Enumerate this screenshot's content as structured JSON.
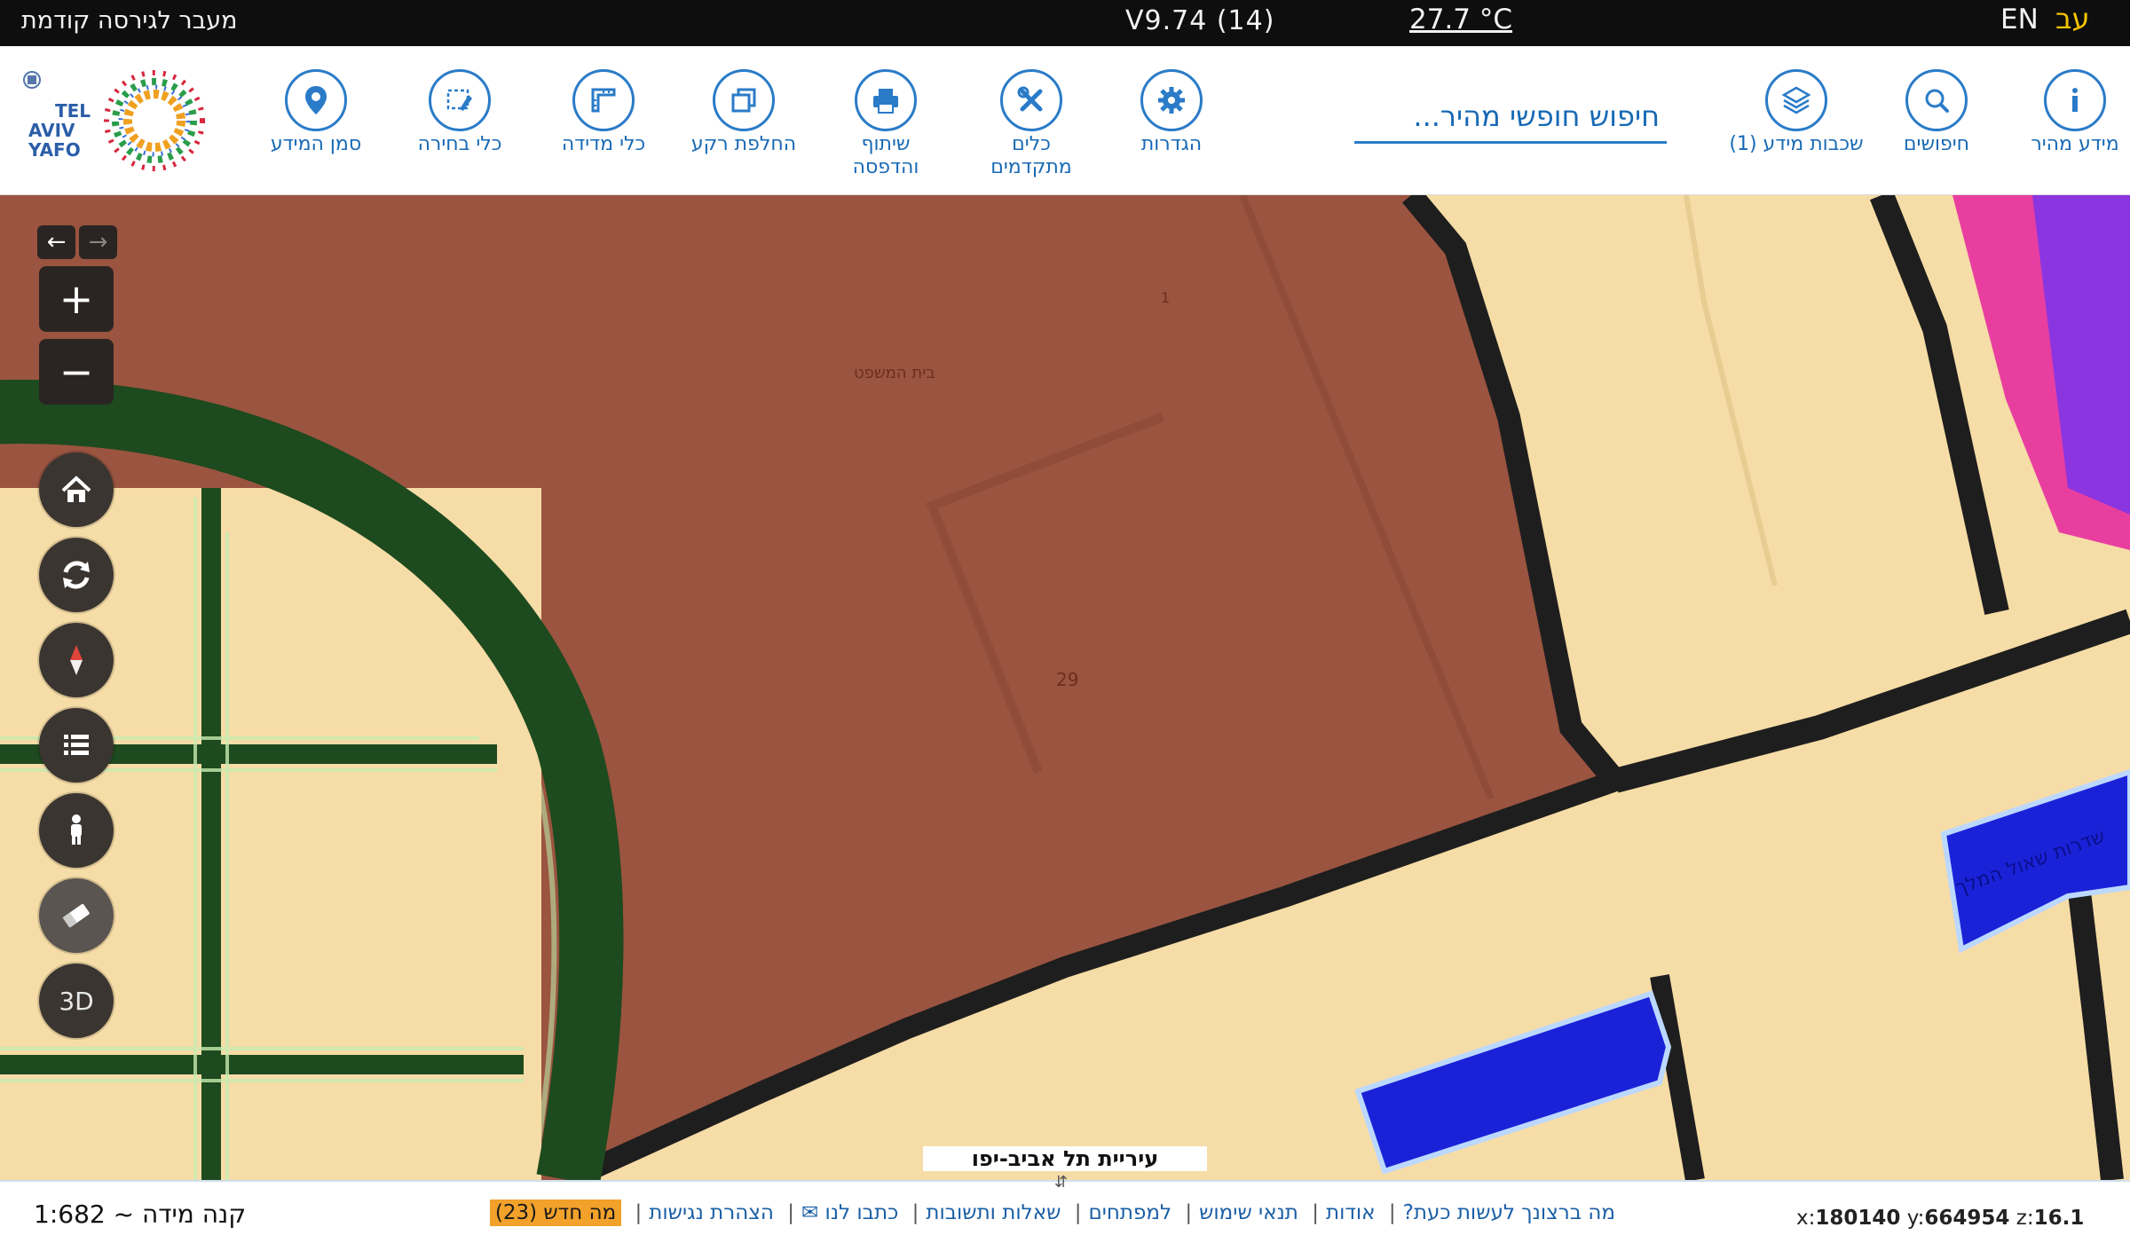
{
  "topbar": {
    "prev_version": "מעבר לגירסה קודמת",
    "version": "V9.74 (14)",
    "temperature": "27.7 °C",
    "lang_en": "EN",
    "lang_he": "עב"
  },
  "toolbar": {
    "search_placeholder": "חיפוש חופשי מהיר...",
    "tools": [
      {
        "label": "מידע מהיר",
        "icon": "info-icon"
      },
      {
        "label": "חיפושים",
        "icon": "search-icon"
      },
      {
        "label": "שכבות מידע (1)",
        "icon": "layers-icon"
      },
      {
        "label": "הגדרות",
        "icon": "gear-icon"
      },
      {
        "label": "כלים מתקדמים",
        "icon": "tools-icon"
      },
      {
        "label": "שיתוף והדפסה",
        "icon": "print-icon"
      },
      {
        "label": "החלפת רקע",
        "icon": "basemap-icon"
      },
      {
        "label": "כלי מדידה",
        "icon": "ruler-icon"
      },
      {
        "label": "כלי בחירה",
        "icon": "select-icon"
      },
      {
        "label": "סמן המידע",
        "icon": "marker-icon"
      }
    ],
    "logo_text": "תל אביב יפו TEL AVIV YAFO"
  },
  "map": {
    "labels": {
      "court": "בית המשפט",
      "parcel_1": "1",
      "parcel_29": "29",
      "street": "שדרות שאול המלך"
    },
    "caption": "עיריית תל אביב-יפו",
    "controls": [
      "back-arrow",
      "forward-arrow",
      "zoom-in",
      "zoom-out",
      "home",
      "refresh",
      "compass",
      "legend",
      "street-view",
      "eraser",
      "3D"
    ],
    "threed_label": "3D"
  },
  "bottombar": {
    "coords": {
      "x_label": "x:",
      "x": "180140",
      "y_label": "y:",
      "y": "664954",
      "z_label": "z:",
      "z": "16.1"
    },
    "links": [
      "מה ברצונך לעשות כעת?",
      "אודות",
      "תנאי שימוש",
      "למפתחים",
      "שאלות ותשובות",
      "כתבו לנו ✉",
      "הצהרת נגישות"
    ],
    "whats_new": "מה חדש (23)",
    "scale": "קנה מידה ~ 1:682"
  },
  "colors": {
    "accent_blue": "#2a7bc8",
    "topbar_bg": "#0e0e0e",
    "lang_active": "#f4c400",
    "map_brown": "#9a5440",
    "map_beige": "#f6dca6",
    "whats_new_bg": "#f2a12b"
  }
}
